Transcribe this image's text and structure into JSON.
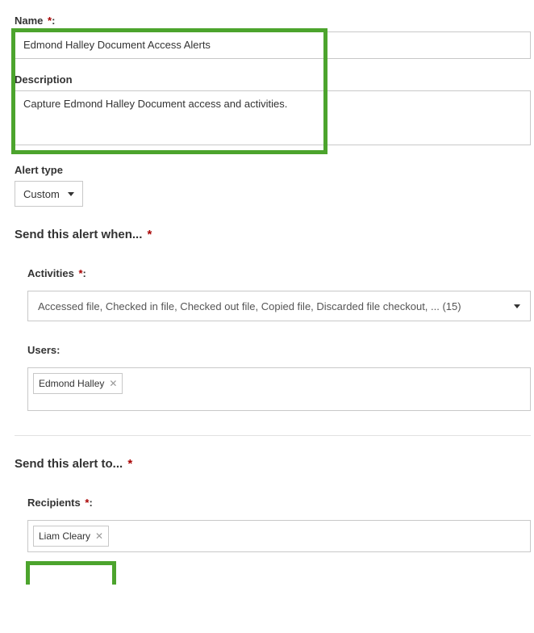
{
  "name": {
    "label": "Name",
    "required_marker": "*",
    "value": "Edmond Halley Document Access Alerts"
  },
  "description": {
    "label": "Description",
    "value": "Capture Edmond Halley Document access and activities."
  },
  "alert_type": {
    "label": "Alert type",
    "value": "Custom"
  },
  "send_when": {
    "heading": "Send this alert when...",
    "required_marker": "*",
    "activities": {
      "label": "Activities",
      "required_marker": "*",
      "summary": "Accessed file,  Checked in file,  Checked out file,  Copied file,  Discarded file checkout, ... (15)"
    },
    "users": {
      "label": "Users:",
      "chips": [
        {
          "name": "Edmond Halley"
        }
      ]
    }
  },
  "send_to": {
    "heading": "Send this alert to...",
    "required_marker": "*",
    "recipients": {
      "label": "Recipients",
      "required_marker": "*",
      "chips": [
        {
          "name": "Liam Cleary"
        }
      ]
    }
  }
}
